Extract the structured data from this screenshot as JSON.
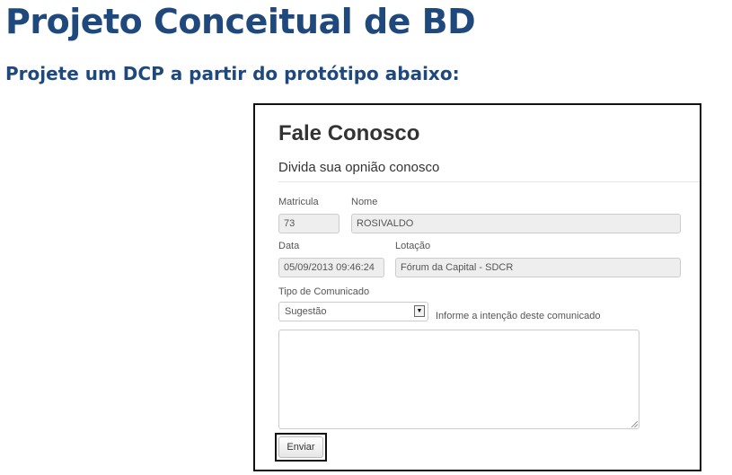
{
  "slide": {
    "title": "Projeto Conceitual de BD",
    "subtitle": "Projete um DCP a partir do protótipo abaixo:"
  },
  "form": {
    "title": "Fale Conosco",
    "legend": "Divida sua opnião conosco",
    "fields": {
      "matricula": {
        "label": "Matricula",
        "value": "73"
      },
      "nome": {
        "label": "Nome",
        "value": "ROSIVALDO"
      },
      "data": {
        "label": "Data",
        "value": "05/09/2013 09:46:24"
      },
      "lotacao": {
        "label": "Lotação",
        "value": "Fórum da Capital - SDCR"
      }
    },
    "tipo_comunicado": {
      "label": "Tipo de Comunicado",
      "selected": "Sugestão",
      "hint": "Informe a intenção deste comunicado"
    },
    "message": {
      "value": ""
    },
    "submit_label": "Enviar"
  },
  "icons": {
    "select_toggle": "chevron-down-icon",
    "textarea_resize": "resize-grip-icon"
  },
  "colors": {
    "heading": "#1f497d",
    "readonly_bg": "#eeeeee",
    "frame_border": "#111111"
  }
}
